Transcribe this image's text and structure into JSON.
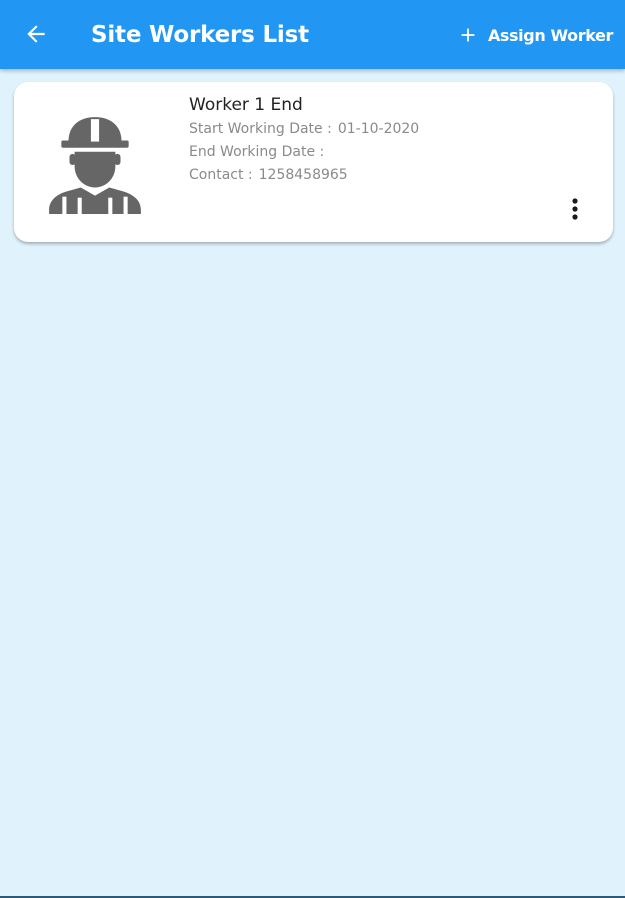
{
  "header": {
    "back_icon": "arrow-left-icon",
    "title": "Site Workers List",
    "assign_icon": "plus-icon",
    "assign_label": "Assign Worker"
  },
  "workers": [
    {
      "avatar_icon": "construction-worker-icon",
      "name": "Worker 1 End",
      "start_label": "Start Working Date :",
      "start_value": "01-10-2020",
      "end_label": "End Working Date :",
      "end_value": "",
      "contact_label": "Contact :",
      "contact_value": "1258458965",
      "menu_icon": "more-vert-icon"
    }
  ],
  "colors": {
    "app_bar": "#2196f3",
    "background": "#e0f3fd",
    "card": "#ffffff",
    "name_text": "#222222",
    "detail_text": "#8a8a8a",
    "avatar": "#666666"
  }
}
